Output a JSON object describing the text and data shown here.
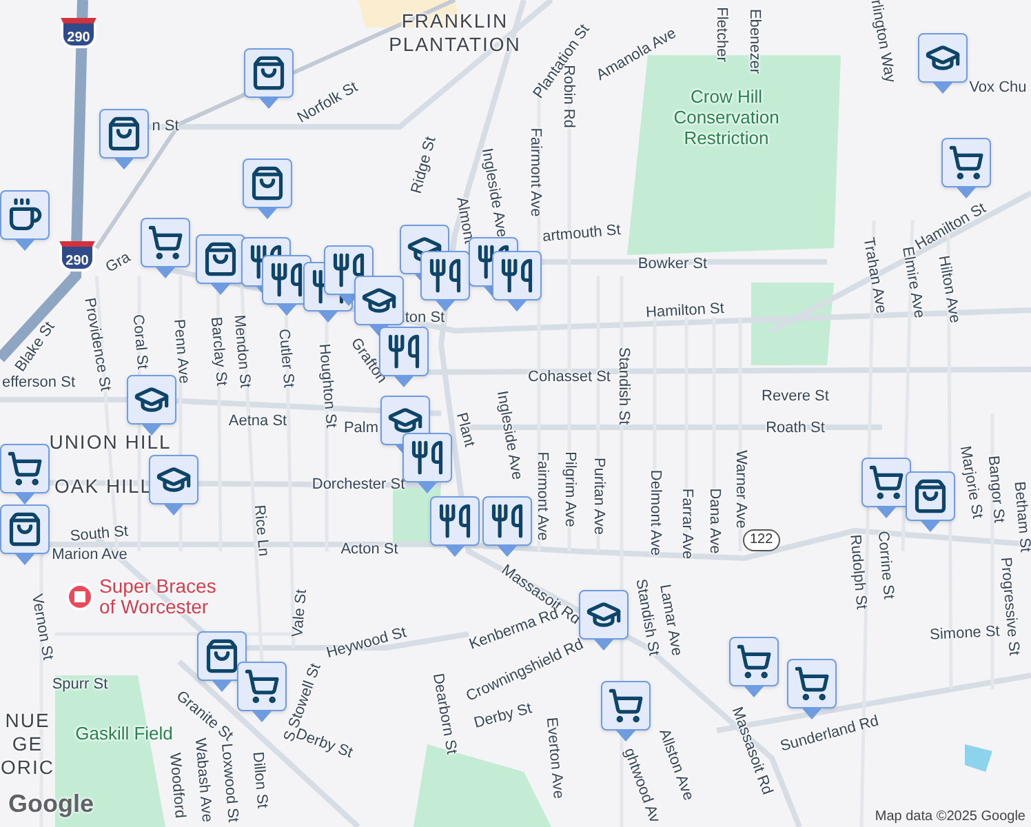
{
  "map": {
    "areas": [
      {
        "lines": [
          "FRANKLIN",
          "PLANTATION"
        ]
      },
      {
        "lines": [
          "UNION HILL"
        ]
      },
      {
        "lines": [
          "OAK HILL"
        ]
      },
      {
        "lines": [
          "NUE",
          "GE",
          "ORIC"
        ]
      }
    ],
    "streets": [
      "Plantation St",
      "Amanola Ave",
      "Robin Rd",
      "Fletcher",
      "Ebenezer",
      "Norfolk St",
      "Ridge St",
      "Ingleside Ave",
      "Fairmont Ave",
      "Almont",
      "artmouth St",
      "Bowker St",
      "Hamilton St",
      "Hamilton St",
      "Cohasset St",
      "Revere St",
      "Roath St",
      "Standish St",
      "Puritan Ave",
      "Pilgrim Ave",
      "Fairmont Ave",
      "Ingleside Ave",
      "Delmont Ave",
      "Farrar Ave",
      "Dana Ave",
      "Warner Ave",
      "Trahan Ave",
      "Elmire Ave",
      "Hilton Ave",
      "Marjorie St",
      "Bangor St",
      "Betham St",
      "Rudolph St",
      "Corrine St",
      "Simone St",
      "Progressive St",
      "Acton St",
      "Massasoit Rd",
      "Massasoit Rd",
      "Standish St",
      "Lamar Ave",
      "Kenberma Rd",
      "Crowningshield Rd",
      "Derby St",
      "Everton Ave",
      "Allston Ave",
      "Sunderland Rd",
      "Heywood St",
      "Dearborn St",
      "S Stowell St",
      "Derby St",
      "Granite St",
      "Dillon St",
      "Loxwood St",
      "Wabash Ave",
      "Woodford",
      "South St",
      "Marion Ave",
      "Spurr St",
      "Vernon St",
      "Vale St",
      "Rice Ln",
      "Palm",
      "Dorchester St",
      "Aetna St",
      "efferson St",
      "Houghton St",
      "Cutler St",
      "Mendon St",
      "Barclay St",
      "Penn Ave",
      "Coral St",
      "Providence St",
      "Blake St",
      "Gra",
      "Grafton",
      "lton St",
      "Plant",
      "n St",
      "Vox Chu",
      "rlington Way",
      "ghtwood Av"
    ],
    "parks": [
      {
        "lines": [
          "Crow Hill",
          "Conservation",
          "Restriction"
        ]
      },
      {
        "lines": [
          "Gaskill Field"
        ]
      }
    ],
    "poi": {
      "lines": [
        "Super Braces",
        "of Worcester"
      ]
    },
    "shields": [
      {
        "number": "290",
        "kind": "interstate"
      },
      {
        "number": "290",
        "kind": "interstate"
      },
      {
        "number": "122",
        "kind": "state"
      }
    ],
    "pins": [
      {
        "kind": "bag"
      },
      {
        "kind": "bag"
      },
      {
        "kind": "bag"
      },
      {
        "kind": "cup"
      },
      {
        "kind": "cart"
      },
      {
        "kind": "bag"
      },
      {
        "kind": "fork"
      },
      {
        "kind": "fork"
      },
      {
        "kind": "fork"
      },
      {
        "kind": "fork"
      },
      {
        "kind": "school"
      },
      {
        "kind": "fork"
      },
      {
        "kind": "fork"
      },
      {
        "kind": "fork"
      },
      {
        "kind": "school"
      },
      {
        "kind": "fork"
      },
      {
        "kind": "school"
      },
      {
        "kind": "school"
      },
      {
        "kind": "school"
      },
      {
        "kind": "cart"
      },
      {
        "kind": "bag"
      },
      {
        "kind": "fork"
      },
      {
        "kind": "fork"
      },
      {
        "kind": "fork"
      },
      {
        "kind": "school"
      },
      {
        "kind": "bag"
      },
      {
        "kind": "cart"
      },
      {
        "kind": "cart"
      },
      {
        "kind": "cart"
      },
      {
        "kind": "cart"
      },
      {
        "kind": "cart"
      },
      {
        "kind": "bag"
      },
      {
        "kind": "school"
      },
      {
        "kind": "cart"
      }
    ]
  },
  "logo": "Google",
  "attribution": "Map data ©2025 Google"
}
